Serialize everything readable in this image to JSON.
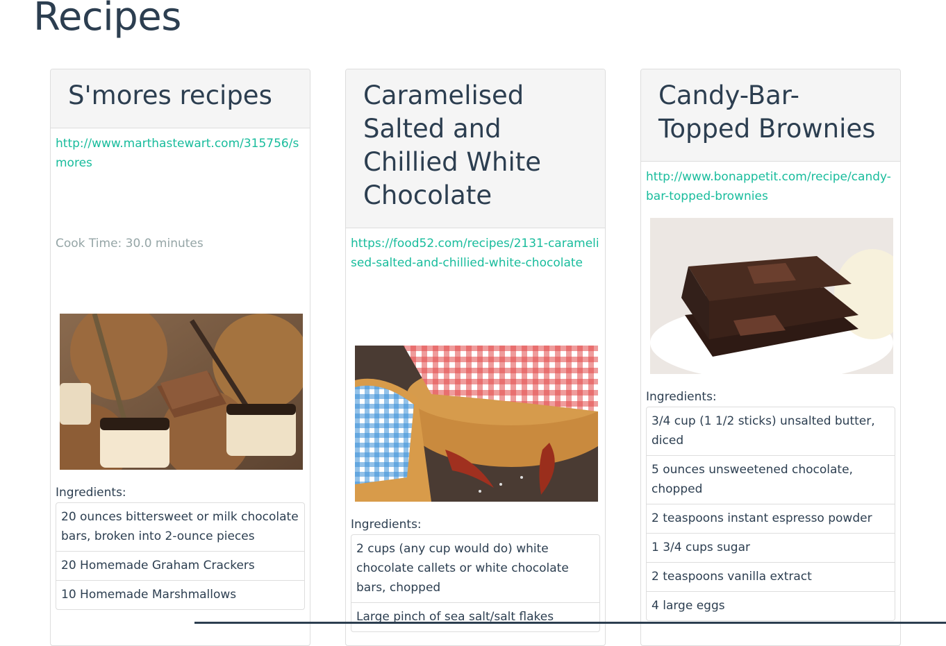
{
  "page": {
    "title": "Recipes"
  },
  "recipes": [
    {
      "title": "S'mores recipes",
      "url": "http://www.marthastewart.com/315756/smores",
      "cook_time": "Cook Time: 30.0 minutes",
      "ingredients_label": "Ingredients:",
      "ingredients": [
        "20 ounces bittersweet or milk chocolate bars, broken into 2-ounce pieces",
        "20 Homemade Graham Crackers",
        "10 Homemade Marshmallows"
      ]
    },
    {
      "title": "Caramelised Salted and Chillied White Chocolate",
      "url": "https://food52.com/recipes/2131-caramelised-salted-and-chillied-white-chocolate",
      "ingredients_label": "Ingredients:",
      "ingredients": [
        "2 cups (any cup would do) white chocolate callets or white chocolate bars, chopped",
        "Large pinch of sea salt/salt flakes"
      ]
    },
    {
      "title": "Candy-Bar-Topped Brownies",
      "url": "http://www.bonappetit.com/recipe/candy-bar-topped-brownies",
      "ingredients_label": "Ingredients:",
      "ingredients": [
        "3/4 cup (1 1/2 sticks) unsalted butter, diced",
        "5 ounces unsweetened chocolate, chopped",
        "2 teaspoons instant espresso powder",
        "1 3/4 cups sugar",
        "2 teaspoons vanilla extract",
        "4 large eggs"
      ]
    }
  ]
}
